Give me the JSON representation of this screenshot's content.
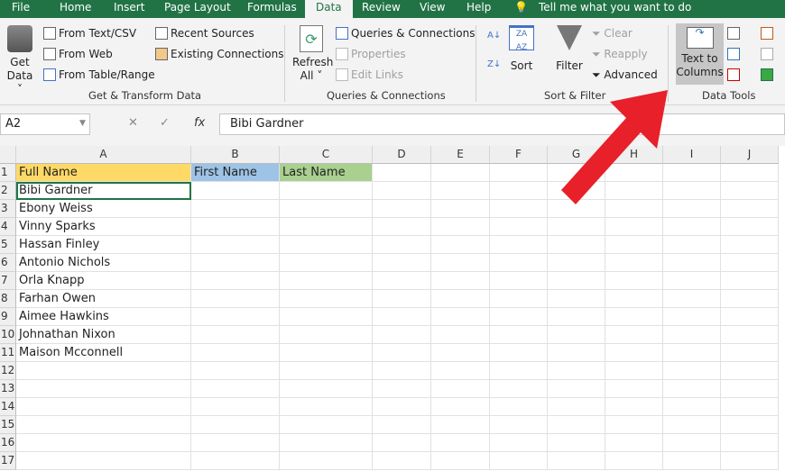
{
  "tabs": [
    "File",
    "Home",
    "Insert",
    "Page Layout",
    "Formulas",
    "Data",
    "Review",
    "View",
    "Help"
  ],
  "tell_me": "Tell me what you want to do",
  "ribbon": {
    "get_data": [
      "Get",
      "Data ˅"
    ],
    "from_text": "From Text/CSV",
    "from_web": "From Web",
    "from_table": "From Table/Range",
    "recent": "Recent Sources",
    "existing": "Existing Connections",
    "group1": "Get & Transform Data",
    "refresh": [
      "Refresh",
      "All ˅"
    ],
    "queries": "Queries & Connections",
    "properties": "Properties",
    "edit_links": "Edit Links",
    "group2": "Queries & Connections",
    "sort": "Sort",
    "filter": "Filter",
    "clear": "Clear",
    "reapply": "Reapply",
    "advanced": "Advanced",
    "group3": "Sort & Filter",
    "text_to_columns": [
      "Text to",
      "Columns"
    ],
    "group4": "Data Tools"
  },
  "name_box": "A2",
  "formula": "Bibi Gardner",
  "columns": [
    "A",
    "B",
    "C",
    "D",
    "E",
    "F",
    "G",
    "H",
    "I",
    "J"
  ],
  "rows": [
    "1",
    "2",
    "3",
    "4",
    "5",
    "6",
    "7",
    "8",
    "9",
    "10",
    "11",
    "12",
    "13",
    "14",
    "15",
    "16",
    "17"
  ],
  "headers": {
    "a": "Full Name",
    "b": "First Name",
    "c": "Last Name"
  },
  "names": [
    "Bibi Gardner",
    "Ebony Weiss",
    "Vinny Sparks",
    "Hassan Finley",
    "Antonio Nichols",
    "Orla Knapp",
    "Farhan Owen",
    "Aimee Hawkins",
    "Johnathan Nixon",
    "Maison Mcconnell"
  ],
  "colors": {
    "header_a": "#ffd966",
    "header_b": "#9dc3e6",
    "header_c": "#a9d08e",
    "arrow": "#e8202a",
    "excel_green": "#217346"
  }
}
